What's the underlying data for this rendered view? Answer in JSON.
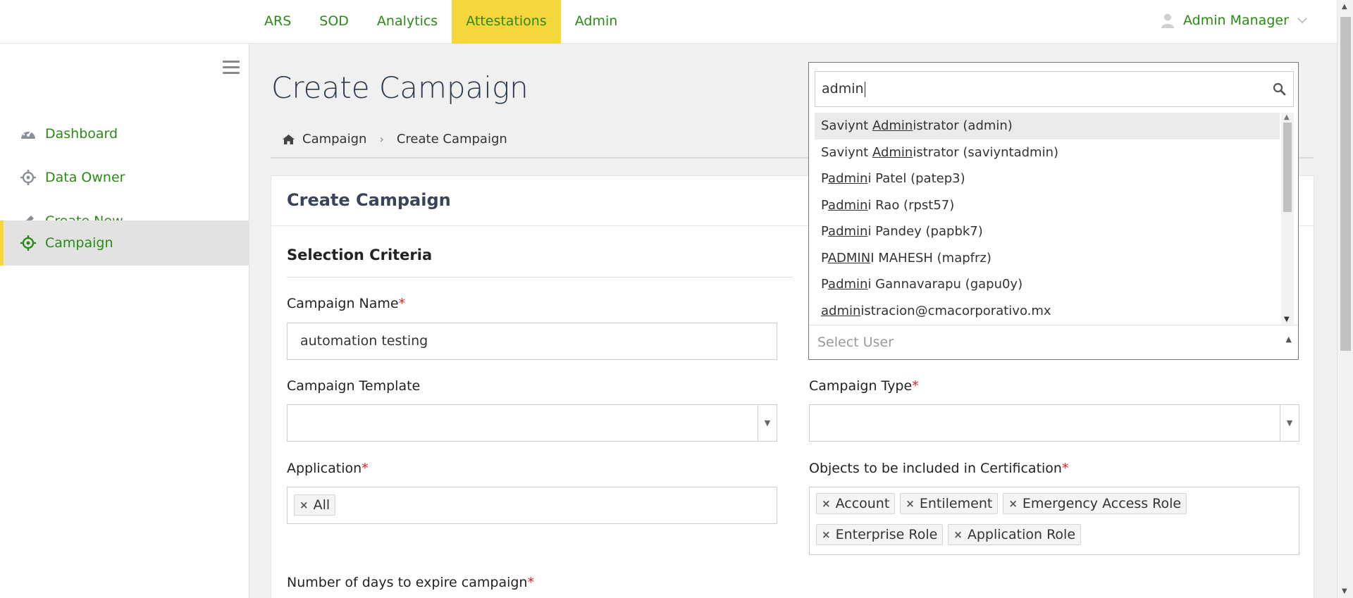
{
  "nav": {
    "items": [
      {
        "label": "ARS",
        "active": false
      },
      {
        "label": "SOD",
        "active": false
      },
      {
        "label": "Analytics",
        "active": false
      },
      {
        "label": "Attestations",
        "active": true
      },
      {
        "label": "Admin",
        "active": false
      }
    ],
    "user": "Admin Manager"
  },
  "sidebar": {
    "items": [
      {
        "label": "Dashboard",
        "icon": "dashboard-icon",
        "active": false
      },
      {
        "label": "Data Owner",
        "icon": "data-owner-icon",
        "active": false
      },
      {
        "label": "Create New",
        "icon": "pencil-icon",
        "active": false
      },
      {
        "label": "Campaign",
        "icon": "campaign-icon",
        "active": true
      }
    ]
  },
  "page": {
    "title": "Create Campaign",
    "breadcrumb": {
      "home": "Campaign",
      "current": "Create Campaign"
    }
  },
  "card": {
    "title": "Create Campaign",
    "section": "Selection Criteria"
  },
  "form": {
    "campaign_name": {
      "label": "Campaign Name",
      "required": "*",
      "value": "automation testing"
    },
    "campaign_template": {
      "label": "Campaign Template",
      "value": ""
    },
    "campaign_type": {
      "label": "Campaign Type",
      "required": "*",
      "value": ""
    },
    "application": {
      "label": "Application",
      "required": "*",
      "tags": [
        "All"
      ]
    },
    "objects": {
      "label": "Objects to be included in Certification",
      "required": "*",
      "tags": [
        "Account",
        "Entilement",
        "Emergency Access Role",
        "Enterprise Role",
        "Application Role"
      ]
    },
    "expire_days": {
      "label": "Number of days to expire campaign",
      "required": "*"
    }
  },
  "user_dropdown": {
    "search_value": "admin",
    "placeholder": "Select User",
    "options": [
      {
        "pre": "Saviynt ",
        "match": "Admin",
        "post": "istrator (admin)",
        "highlighted": true
      },
      {
        "pre": "Saviynt ",
        "match": "Admin",
        "post": "istrator (saviyntadmin)",
        "highlighted": false
      },
      {
        "pre": "P",
        "match": "admin",
        "post": "i Patel (patep3)",
        "highlighted": false
      },
      {
        "pre": "P",
        "match": "admin",
        "post": "i Rao (rpst57)",
        "highlighted": false
      },
      {
        "pre": "P",
        "match": "admin",
        "post": "i Pandey (papbk7)",
        "highlighted": false
      },
      {
        "pre": "P",
        "match": "ADMIN",
        "post": "I MAHESH (mapfrz)",
        "highlighted": false
      },
      {
        "pre": "P",
        "match": "admin",
        "post": "i Gannavarapu (gapu0y)",
        "highlighted": false
      },
      {
        "pre": "",
        "match": "admin",
        "post": "istracion@cmacorporativo.mx",
        "highlighted": false
      }
    ]
  }
}
